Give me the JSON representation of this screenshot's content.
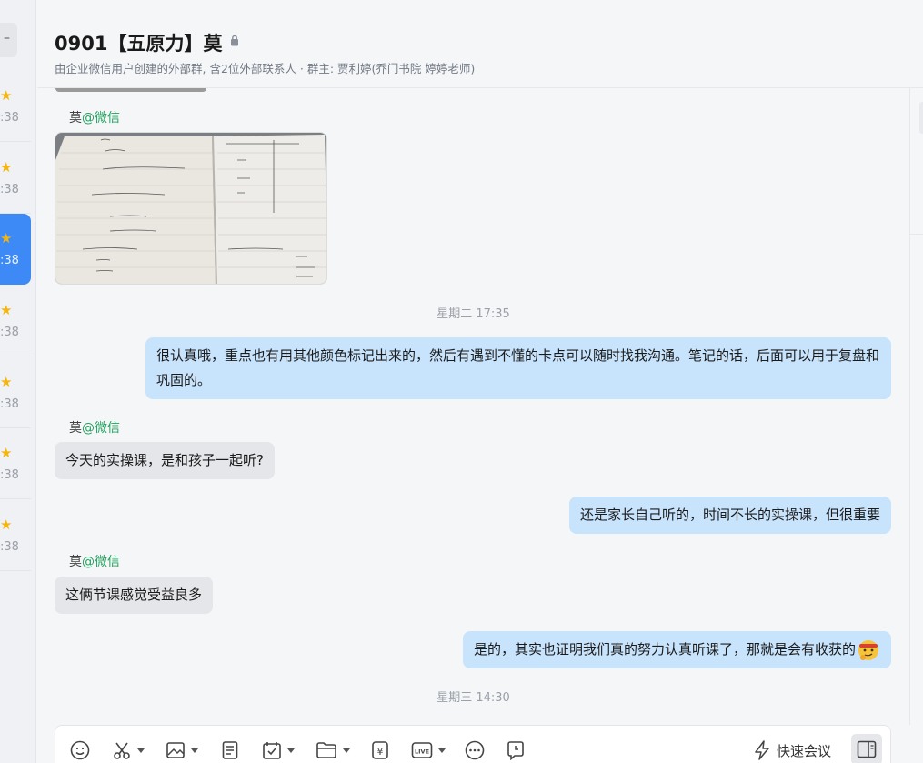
{
  "sidebar": {
    "conversations": [
      {
        "time": ":38",
        "starred": true
      },
      {
        "time": ":38",
        "starred": true
      },
      {
        "time": ":38",
        "starred": true,
        "active": true
      },
      {
        "time": ":38",
        "starred": true
      },
      {
        "time": ":38",
        "starred": true
      },
      {
        "time": ":38",
        "starred": true
      },
      {
        "time": ":38",
        "starred": true
      }
    ]
  },
  "header": {
    "title": "0901【五原力】莫",
    "subtitle": "由企业微信用户创建的外部群, 含2位外部联系人 · 群主: 贾利婷(乔门书院 婷婷老师)"
  },
  "messages": {
    "sender_name": "莫",
    "sender_source": "@微信",
    "time_1": "星期二 17:35",
    "out_1": "很认真哦，重点也有用其他颜色标记出来的，然后有遇到不懂的卡点可以随时找我沟通。笔记的话，后面可以用于复盘和巩固的。",
    "in_1": "今天的实操课，是和孩子一起听?",
    "out_2": "还是家长自己听的，时间不长的实操课，但很重要",
    "in_2": "这俩节课感觉受益良多",
    "out_3": "是的，其实也证明我们真的努力认真听课了，那就是会有收获的",
    "time_2": "星期三 14:30"
  },
  "toolbar": {
    "quick_meeting": "快速会议",
    "live_label": "LIVE",
    "yen": "¥"
  },
  "colors": {
    "accent": "#3d8af7",
    "out_bubble": "#c8e3fc",
    "in_bubble": "#e5e6e9",
    "wechat_green": "#21a35e",
    "star": "#f5b50a"
  }
}
